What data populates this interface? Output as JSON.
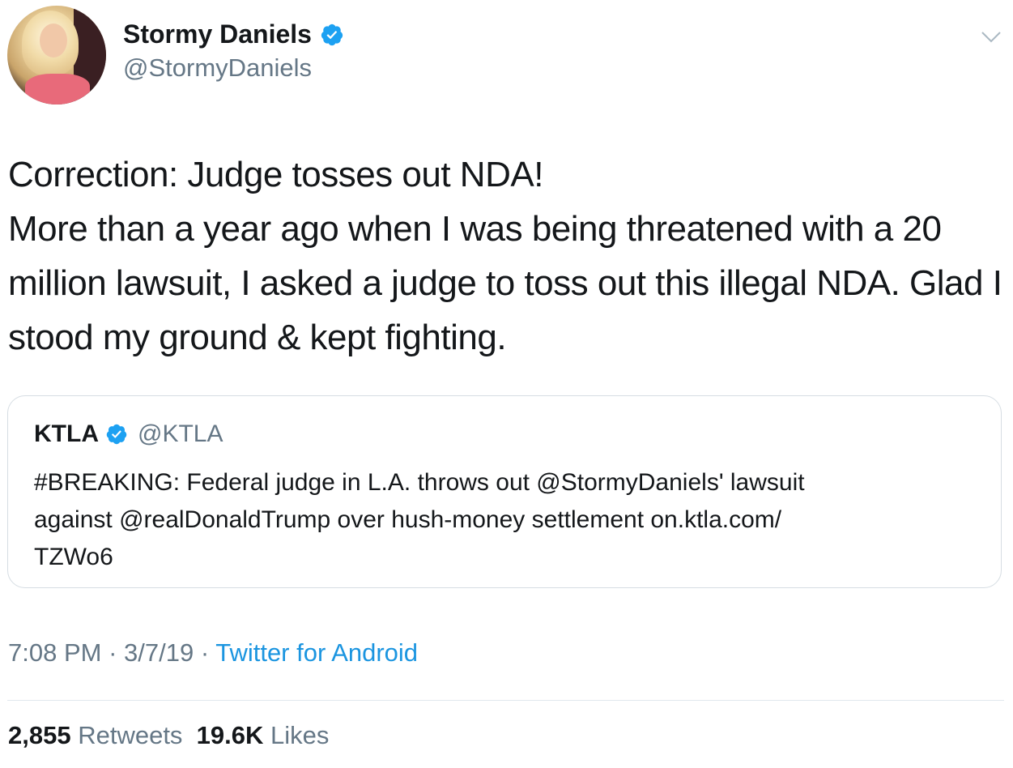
{
  "author": {
    "name": "Stormy Daniels",
    "handle": "@StormyDaniels"
  },
  "tweet": {
    "lines": [
      "Correction: Judge tosses out NDA!",
      "More than a year ago when I was being threatened with a 20",
      "million lawsuit, I asked a judge to toss out this illegal NDA. Glad I",
      "stood my ground & kept fighting."
    ]
  },
  "quoted_tweet": {
    "name": "KTLA",
    "handle": "@KTLA",
    "lines": [
      "#BREAKING: Federal judge in L.A. throws out @StormyDaniels' lawsuit",
      "against @realDonaldTrump over hush-money settlement on.ktla.com/",
      "TZWo6"
    ]
  },
  "meta": {
    "time": "7:08 PM",
    "sep1": " · ",
    "date": "3/7/19",
    "sep2": " · ",
    "source": "Twitter for Android"
  },
  "stats": {
    "retweets_count": "2,855",
    "retweets_label": "Retweets",
    "likes_count": "19.6K",
    "likes_label": "Likes"
  },
  "icons": {
    "verified": "verified-badge-icon",
    "menu": "chevron-down-icon"
  },
  "colors": {
    "accent": "#1b95e0",
    "verified": "#1da1f2",
    "muted": "#657786",
    "text": "#14171a",
    "border": "#d6dde3"
  }
}
